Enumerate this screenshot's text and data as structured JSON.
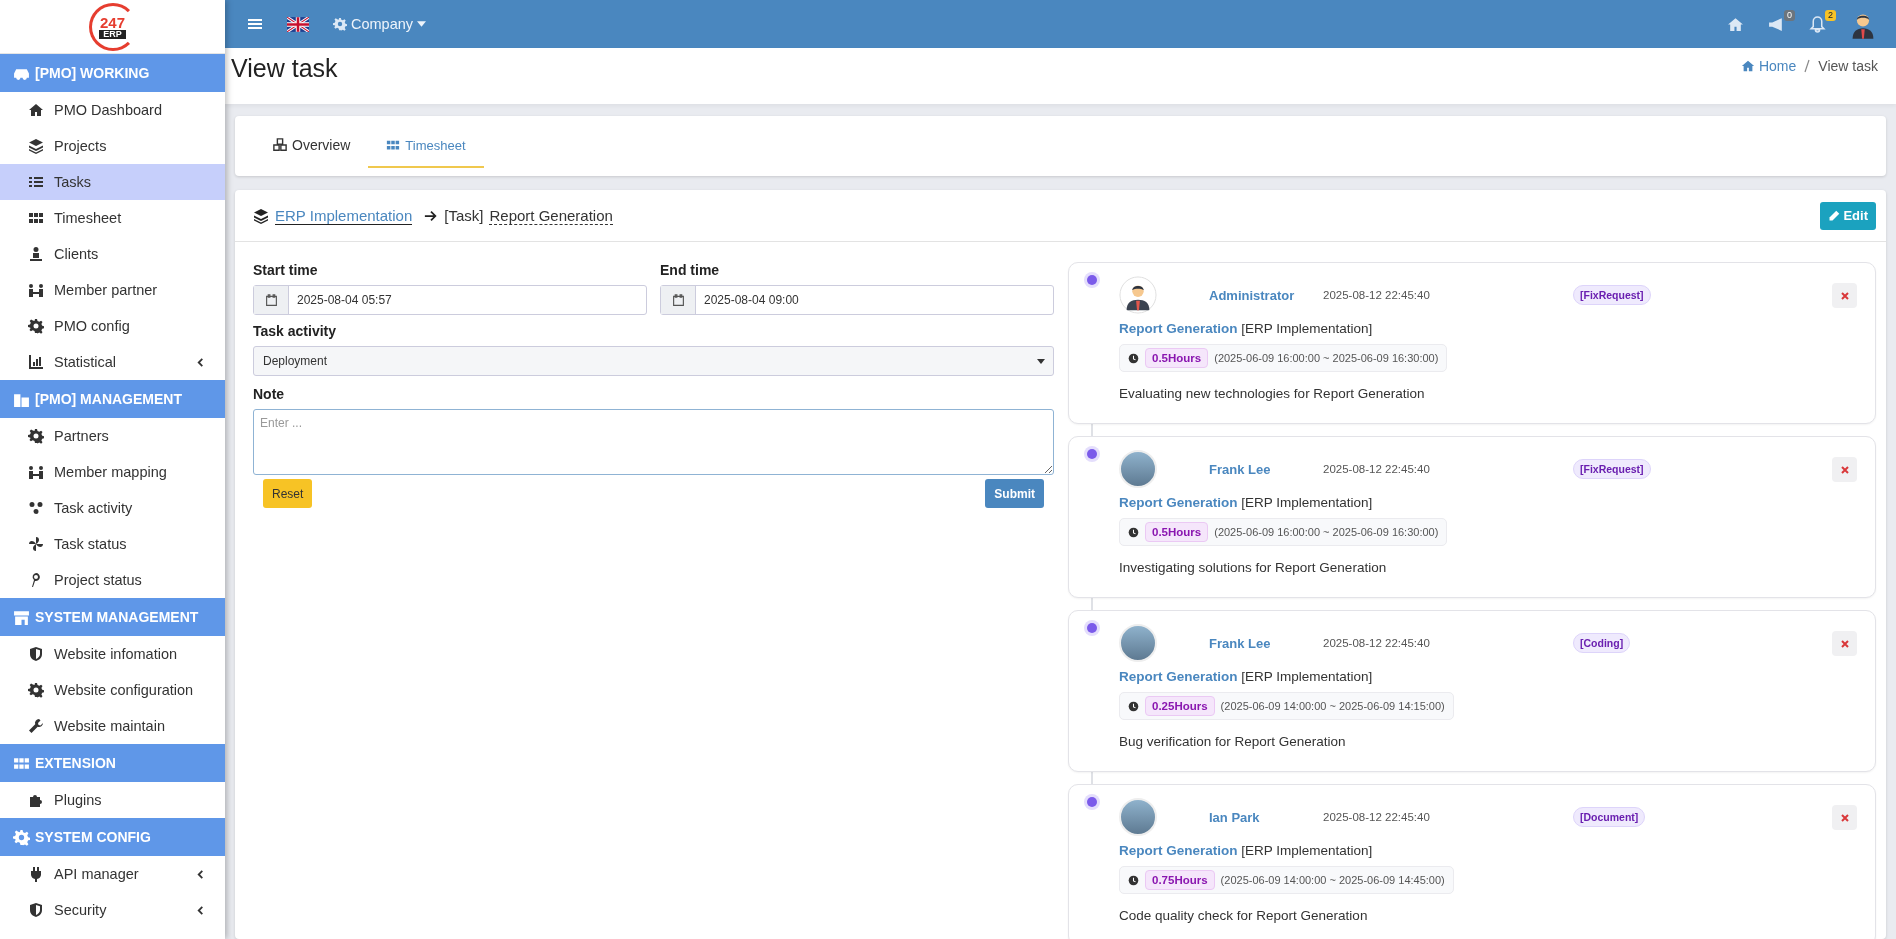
{
  "logo": {
    "text": "247",
    "subtext": "ERP"
  },
  "sidebar": {
    "sections": [
      {
        "title": "[PMO] WORKING",
        "items": [
          {
            "label": "PMO Dashboard",
            "selected": false,
            "has_submenu": false
          },
          {
            "label": "Projects",
            "selected": false,
            "has_submenu": false
          },
          {
            "label": "Tasks",
            "selected": true,
            "has_submenu": false
          },
          {
            "label": "Timesheet",
            "selected": false,
            "has_submenu": false
          },
          {
            "label": "Clients",
            "selected": false,
            "has_submenu": false
          },
          {
            "label": "Member partner",
            "selected": false,
            "has_submenu": false
          },
          {
            "label": "PMO config",
            "selected": false,
            "has_submenu": false
          },
          {
            "label": "Statistical",
            "selected": false,
            "has_submenu": true
          }
        ]
      },
      {
        "title": "[PMO] MANAGEMENT",
        "items": [
          {
            "label": "Partners",
            "selected": false,
            "has_submenu": false
          },
          {
            "label": "Member mapping",
            "selected": false,
            "has_submenu": false
          },
          {
            "label": "Task activity",
            "selected": false,
            "has_submenu": false
          },
          {
            "label": "Task status",
            "selected": false,
            "has_submenu": false
          },
          {
            "label": "Project status",
            "selected": false,
            "has_submenu": false
          }
        ]
      },
      {
        "title": "SYSTEM MANAGEMENT",
        "items": [
          {
            "label": "Website infomation",
            "selected": false,
            "has_submenu": false
          },
          {
            "label": "Website configuration",
            "selected": false,
            "has_submenu": false
          },
          {
            "label": "Website maintain",
            "selected": false,
            "has_submenu": false
          }
        ]
      },
      {
        "title": "EXTENSION",
        "items": [
          {
            "label": "Plugins",
            "selected": false,
            "has_submenu": false
          }
        ]
      },
      {
        "title": "SYSTEM CONFIG",
        "items": [
          {
            "label": "API manager",
            "selected": false,
            "has_submenu": true
          },
          {
            "label": "Security",
            "selected": false,
            "has_submenu": true
          }
        ]
      }
    ]
  },
  "topbar": {
    "company": "Company",
    "announcements_count": "0",
    "notifications_count": "2"
  },
  "page": {
    "title": "View task",
    "breadcrumb": [
      {
        "label": "Home"
      },
      {
        "label": "View task"
      }
    ]
  },
  "tabs": [
    {
      "label": "Overview",
      "selected": false
    },
    {
      "label": "Timesheet",
      "selected": true
    }
  ],
  "task_header": {
    "project": "ERP Implementation",
    "prefix": "[Task]",
    "task": "Report Generation",
    "edit_button": "Edit"
  },
  "form": {
    "start_label": "Start time",
    "start_value": "2025-08-04 05:57",
    "end_label": "End time",
    "end_value": "2025-08-04 09:00",
    "activity_label": "Task activity",
    "activity_value": "Deployment",
    "note_label": "Note",
    "note_placeholder": "Enter ...",
    "reset_button": "Reset",
    "submit_button": "Submit"
  },
  "timeline": [
    {
      "kind": "illustration",
      "name": "Administrator",
      "time": "2025-08-12 22:45:40",
      "tag": "[FixRequest]",
      "task": "Report Generation",
      "project": "[ERP Implementation]",
      "hours": "0.5Hours",
      "range": "(2025-06-09 16:00:00 ~ 2025-06-09 16:30:00)",
      "note": "Evaluating new technologies for Report Generation"
    },
    {
      "kind": "photo",
      "name": "Frank Lee",
      "time": "2025-08-12 22:45:40",
      "tag": "[FixRequest]",
      "task": "Report Generation",
      "project": "[ERP Implementation]",
      "hours": "0.5Hours",
      "range": "(2025-06-09 16:00:00 ~ 2025-06-09 16:30:00)",
      "note": "Investigating solutions for Report Generation"
    },
    {
      "kind": "photo",
      "name": "Frank Lee",
      "time": "2025-08-12 22:45:40",
      "tag": "[Coding]",
      "task": "Report Generation",
      "project": "[ERP Implementation]",
      "hours": "0.25Hours",
      "range": "(2025-06-09 14:00:00 ~ 2025-06-09 14:15:00)",
      "note": "Bug verification for Report Generation"
    },
    {
      "kind": "photo",
      "name": "Ian Park",
      "time": "2025-08-12 22:45:40",
      "tag": "[Document]",
      "task": "Report Generation",
      "project": "[ERP Implementation]",
      "hours": "0.75Hours",
      "range": "(2025-06-09 14:00:00 ~ 2025-06-09 14:45:00)",
      "note": "Code quality check for Report Generation"
    }
  ]
}
